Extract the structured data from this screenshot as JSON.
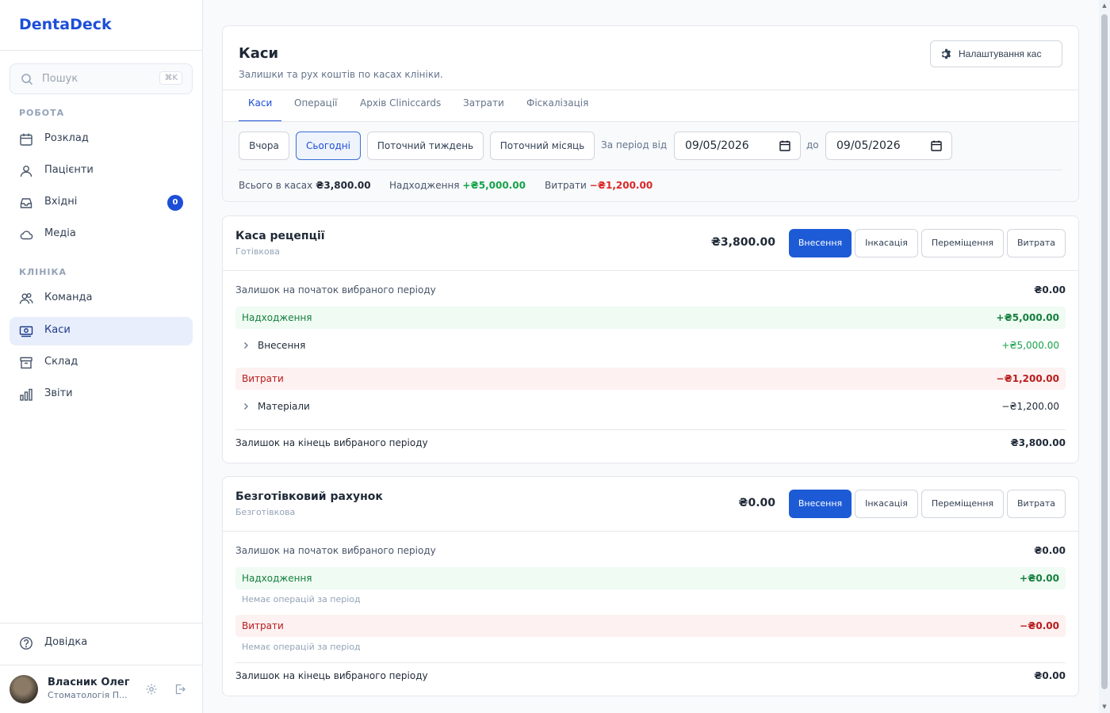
{
  "app": {
    "name": "DentaDeck"
  },
  "search": {
    "placeholder": "Пошук",
    "shortcut": "⌘K"
  },
  "sidebar": {
    "sections": [
      {
        "label": "РОБОТА"
      },
      {
        "label": "КЛІНІКА"
      }
    ],
    "items": [
      {
        "label": "Розклад",
        "icon": "calendar-icon"
      },
      {
        "label": "Пацієнти",
        "icon": "users-icon"
      },
      {
        "label": "Вхідні",
        "icon": "inbox-icon",
        "badge": "0"
      },
      {
        "label": "Медіа",
        "icon": "cloud-icon"
      },
      {
        "label": "Команда",
        "icon": "team-icon"
      },
      {
        "label": "Каси",
        "icon": "cash-icon",
        "active": true
      },
      {
        "label": "Склад",
        "icon": "archive-icon"
      },
      {
        "label": "Звіти",
        "icon": "bar-chart-icon"
      }
    ],
    "help": "Довідка",
    "user": {
      "name": "Власник Олег",
      "org": "Стоматологія П..."
    }
  },
  "header": {
    "title": "Каси",
    "subtitle": "Залишки та рух коштів по касах клініки.",
    "settings_label": "Налаштування кас"
  },
  "tabs": [
    {
      "label": "Каси",
      "active": true
    },
    {
      "label": "Операції"
    },
    {
      "label": "Архів Cliniccards"
    },
    {
      "label": "Затрати"
    },
    {
      "label": "Фіскалізація"
    }
  ],
  "filters": {
    "presets": [
      {
        "label": "Вчора"
      },
      {
        "label": "Сьогодні",
        "active": true
      },
      {
        "label": "Поточний тиждень"
      },
      {
        "label": "Поточний місяць"
      }
    ],
    "period_label": "За період від",
    "from": "09/05/2026",
    "to_label": "до",
    "to": "09/05/2026"
  },
  "summary": {
    "total_label": "Всього в касах",
    "total_value": "₴3,800.00",
    "income_label": "Надходження",
    "income_value": "+₴5,000.00",
    "expense_label": "Витрати",
    "expense_value": "−₴1,200.00"
  },
  "actions": {
    "deposit": "Внесення",
    "collection": "Інкасація",
    "transfer": "Переміщення",
    "expense": "Витрата"
  },
  "cash_registers": [
    {
      "name": "Каса рецепції",
      "type": "Готівкова",
      "amount": "₴3,800.00",
      "start_label": "Залишок на початок вибраного періоду",
      "start_value": "₴0.00",
      "income_label": "Надходження",
      "income_value": "+₴5,000.00",
      "income_items": [
        {
          "label": "Внесення",
          "value": "+₴5,000.00"
        }
      ],
      "expense_label": "Витрати",
      "expense_value": "−₴1,200.00",
      "expense_items": [
        {
          "label": "Матеріали",
          "value": "−₴1,200.00"
        }
      ],
      "end_label": "Залишок на кінець вибраного періоду",
      "end_value": "₴3,800.00"
    },
    {
      "name": "Безготівковий рахунок",
      "type": "Безготівкова",
      "amount": "₴0.00",
      "start_label": "Залишок на початок вибраного періоду",
      "start_value": "₴0.00",
      "income_label": "Надходження",
      "income_value": "+₴0.00",
      "income_empty": "Немає операцій за період",
      "expense_label": "Витрати",
      "expense_value": "−₴0.00",
      "expense_empty": "Немає операцій за період",
      "end_label": "Залишок на кінець вибраного періоду",
      "end_value": "₴0.00"
    }
  ]
}
